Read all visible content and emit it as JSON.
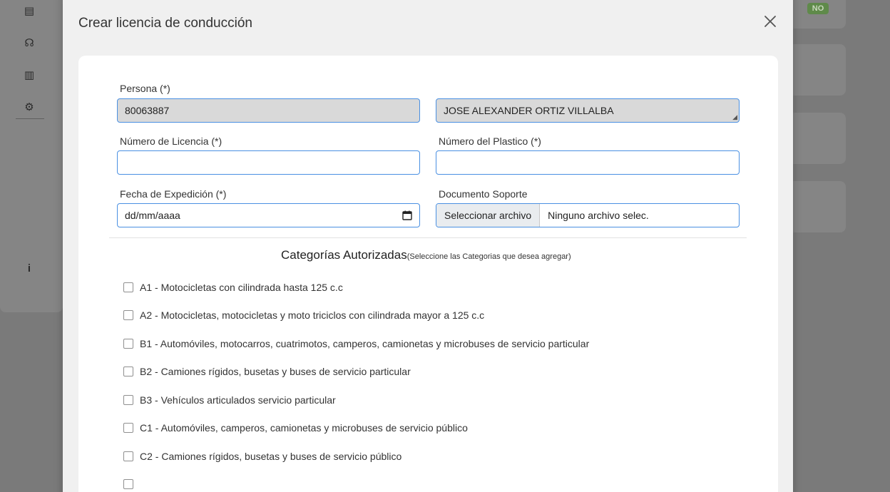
{
  "background": {
    "badge_text": "NO"
  },
  "modal": {
    "title": "Crear licencia de conducción"
  },
  "form": {
    "persona": {
      "label": "Persona (*)",
      "document_value": "80063887",
      "name_value": "JOSE ALEXANDER ORTIZ VILLALBA"
    },
    "numero_licencia": {
      "label": "Número de Licencia (*)",
      "value": ""
    },
    "numero_plastico": {
      "label": "Número del Plastico (*)",
      "value": ""
    },
    "fecha_expedicion": {
      "label": "Fecha de Expedición (*)",
      "value": "dd/mm/aaaa"
    },
    "documento_soporte": {
      "label": "Documento Soporte",
      "button_label": "Seleccionar archivo",
      "file_status": "Ninguno archivo selec."
    }
  },
  "categories": {
    "title": "Categorías Autorizadas",
    "subtitle": "(Seleccione las Categorias que desea agregar)",
    "items": [
      {
        "label": "A1 - Motocicletas con cilindrada hasta 125 c.c",
        "checked": false
      },
      {
        "label": "A2 - Motocicletas, motocicletas y moto triciclos con cilindrada mayor a 125 c.c",
        "checked": false
      },
      {
        "label": "B1 - Automóviles, motocarros, cuatrimotos, camperos, camionetas y microbuses de servicio particular",
        "checked": false
      },
      {
        "label": "B2 - Camiones rígidos, busetas y buses de servicio particular",
        "checked": false
      },
      {
        "label": "B3 - Vehículos articulados servicio particular",
        "checked": false
      },
      {
        "label": "C1 - Automóviles, camperos, camionetas y microbuses de servicio público",
        "checked": false
      },
      {
        "label": "C2 - Camiones rígidos, busetas y buses de servicio público",
        "checked": false
      }
    ]
  },
  "colors": {
    "input_border": "#4a90e2",
    "disabled_bg": "#d9d9d9",
    "overlay": "#7a7a7a"
  }
}
